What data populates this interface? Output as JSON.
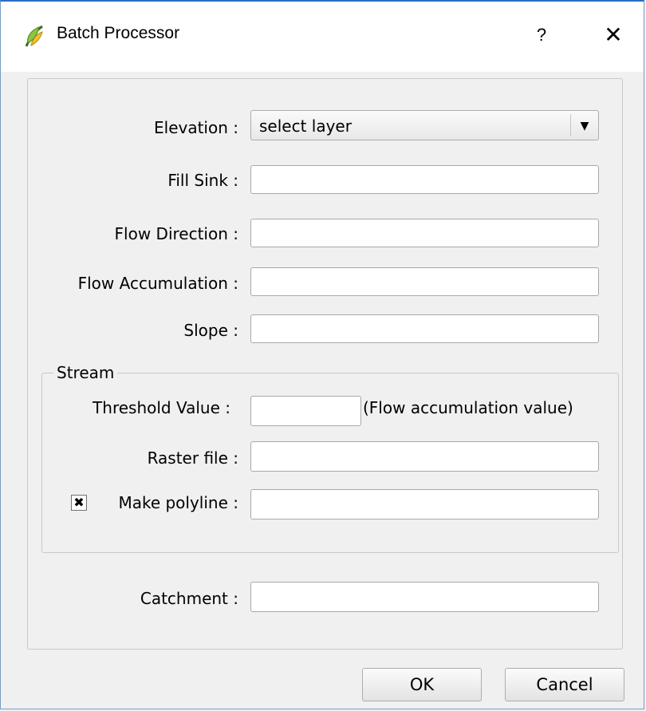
{
  "window": {
    "title": "Batch Processor",
    "help_label": "?",
    "close_label": "✕",
    "accent_color": "#2b6fc6"
  },
  "form": {
    "elevation_label": "Elevation :",
    "elevation_value": "select layer",
    "fill_sink_label": "Fill Sink :",
    "fill_sink_value": "",
    "flow_direction_label": "Flow Direction :",
    "flow_direction_value": "",
    "flow_accumulation_label": "Flow Accumulation :",
    "flow_accumulation_value": "",
    "slope_label": "Slope :",
    "slope_value": "",
    "catchment_label": "Catchment :",
    "catchment_value": ""
  },
  "stream": {
    "group_title": "Stream",
    "threshold_label": "Threshold Value :",
    "threshold_value": "",
    "threshold_hint": "(Flow accumulation value)",
    "raster_label": "Raster file :",
    "raster_value": "",
    "polyline_label": "Make polyline :",
    "polyline_checked_mark": "✖",
    "polyline_value": ""
  },
  "buttons": {
    "ok_label": "OK",
    "cancel_label": "Cancel"
  }
}
